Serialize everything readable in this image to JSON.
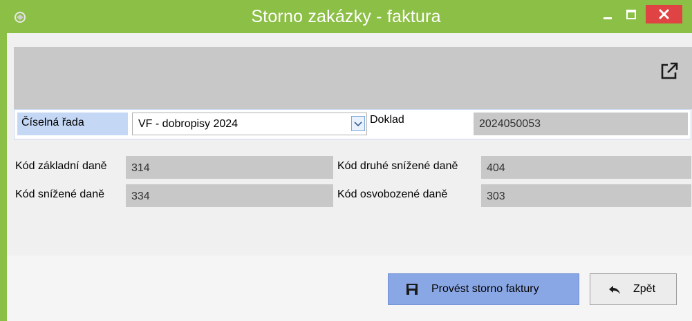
{
  "window": {
    "title": "Storno zakázky - faktura",
    "accent_color": "#8cbf46",
    "close_color": "#e04343"
  },
  "form": {
    "series_label": "Číselná řada",
    "series_value": "VF - dobropisy 2024",
    "doklad_label": "Doklad",
    "doklad_value": "2024050053",
    "tax_basic_label": "Kód základní daně",
    "tax_basic_value": "314",
    "tax_reduced_label": "Kód snížené daně",
    "tax_reduced_value": "334",
    "tax_second_reduced_label": "Kód druhé snížené daně",
    "tax_second_reduced_value": "404",
    "tax_exempt_label": "Kód osvobozené daně",
    "tax_exempt_value": "303"
  },
  "actions": {
    "confirm_label": "Provést storno faktury",
    "back_label": "Zpět",
    "confirm_color": "#8aa7e5"
  },
  "icons": {
    "app": "app-logo-icon",
    "popout": "external-link-icon",
    "save": "save-icon",
    "back": "back-arrow-icon"
  }
}
